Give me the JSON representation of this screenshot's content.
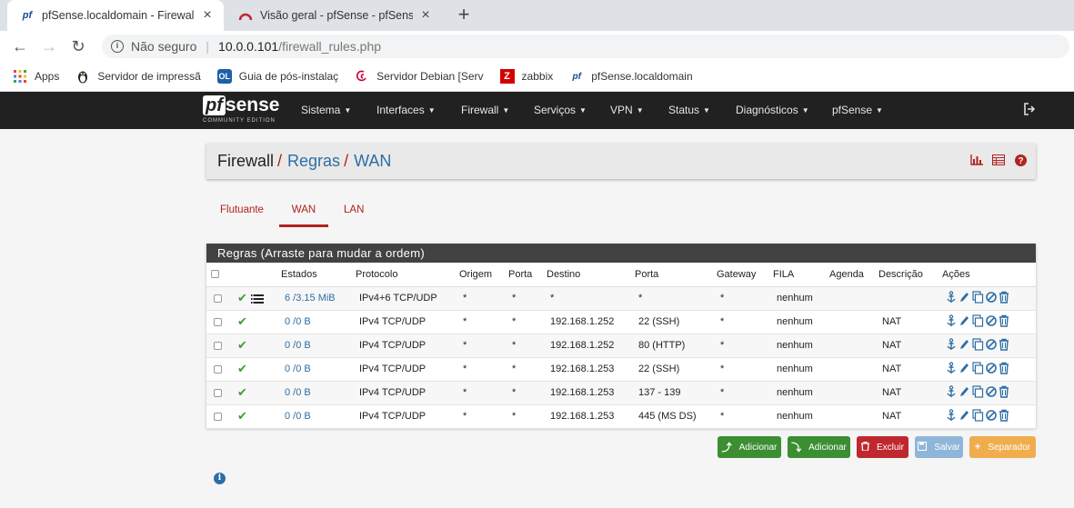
{
  "browser": {
    "tabs": [
      {
        "title": "pfSense.localdomain - Firewall: R",
        "active": true
      },
      {
        "title": "Visão geral - pfSense - pfSense bu",
        "active": false
      }
    ],
    "nav": {
      "back": "←",
      "forward": "→",
      "reload": "↻"
    },
    "address": {
      "security": "Não seguro",
      "host": "10.0.0.101",
      "path": "/firewall_rules.php"
    },
    "bookmarks": [
      {
        "label": "Apps",
        "icon": "apps-icon"
      },
      {
        "label": "Servidor de impressã",
        "icon": "linux-icon"
      },
      {
        "label": "Guia de pós-instalaç",
        "icon": "ol-icon"
      },
      {
        "label": "Servidor Debian [Serv",
        "icon": "debian-icon"
      },
      {
        "label": "zabbix",
        "icon": "zabbix-icon"
      },
      {
        "label": "pfSense.localdomain",
        "icon": "pfsense-icon"
      }
    ]
  },
  "pfnav": {
    "logo_pf": "pf",
    "logo_sense": "sense",
    "logo_edition": "COMMUNITY EDITION",
    "menu": [
      "Sistema",
      "Interfaces",
      "Firewall",
      "Serviços",
      "VPN",
      "Status",
      "Diagnósticos",
      "pfSense"
    ]
  },
  "breadcrumb": {
    "part1": "Firewall",
    "sep": "/",
    "part2": "Regras",
    "part3": "WAN"
  },
  "subtabs": [
    {
      "label": "Flutuante",
      "active": false
    },
    {
      "label": "WAN",
      "active": true
    },
    {
      "label": "LAN",
      "active": false
    }
  ],
  "panel": {
    "title": "Regras (Arraste para mudar a ordem)",
    "columns": [
      "",
      "",
      "Estados",
      "Protocolo",
      "Origem",
      "Porta",
      "Destino",
      "Porta",
      "Gateway",
      "FILA",
      "Agenda",
      "Descrição",
      "Ações"
    ],
    "rows": [
      {
        "states": "6 /3.15 MiB",
        "protocol": "IPv4+6 TCP/UDP",
        "source": "*",
        "sport": "*",
        "dest": "*",
        "dport": "*",
        "gateway": "*",
        "queue": "nenhum",
        "schedule": "",
        "desc": ""
      },
      {
        "states": "0 /0 B",
        "protocol": "IPv4 TCP/UDP",
        "source": "*",
        "sport": "*",
        "dest": "192.168.1.252",
        "dport": "22 (SSH)",
        "gateway": "*",
        "queue": "nenhum",
        "schedule": "",
        "desc": "NAT"
      },
      {
        "states": "0 /0 B",
        "protocol": "IPv4 TCP/UDP",
        "source": "*",
        "sport": "*",
        "dest": "192.168.1.252",
        "dport": "80 (HTTP)",
        "gateway": "*",
        "queue": "nenhum",
        "schedule": "",
        "desc": "NAT"
      },
      {
        "states": "0 /0 B",
        "protocol": "IPv4 TCP/UDP",
        "source": "*",
        "sport": "*",
        "dest": "192.168.1.253",
        "dport": "22 (SSH)",
        "gateway": "*",
        "queue": "nenhum",
        "schedule": "",
        "desc": "NAT"
      },
      {
        "states": "0 /0 B",
        "protocol": "IPv4 TCP/UDP",
        "source": "*",
        "sport": "*",
        "dest": "192.168.1.253",
        "dport": "137 - 139",
        "gateway": "*",
        "queue": "nenhum",
        "schedule": "",
        "desc": "NAT"
      },
      {
        "states": "0 /0 B",
        "protocol": "IPv4 TCP/UDP",
        "source": "*",
        "sport": "*",
        "dest": "192.168.1.253",
        "dport": "445 (MS DS)",
        "gateway": "*",
        "queue": "nenhum",
        "schedule": "",
        "desc": "NAT"
      }
    ]
  },
  "buttons": {
    "add_top": "Adicionar",
    "add_bottom": "Adicionar",
    "delete": "Excluir",
    "save": "Salvar",
    "separator": "Separador"
  },
  "colors": {
    "accent": "#b0231f",
    "link": "#2e6ea5",
    "navbar": "#212121",
    "panel_head": "#424242",
    "pass": "#3c9d31"
  }
}
